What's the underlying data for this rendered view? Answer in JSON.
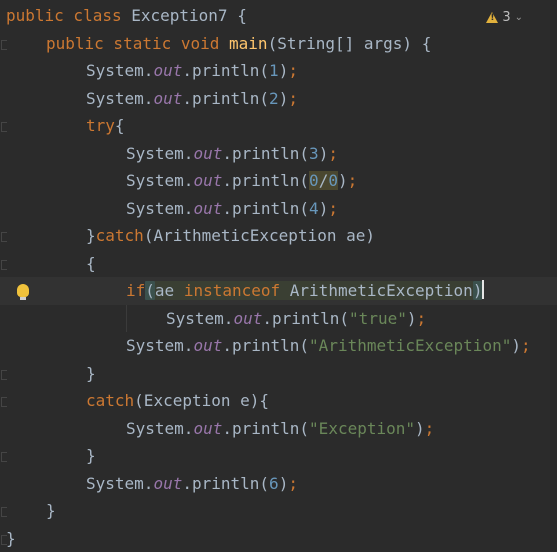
{
  "editor": {
    "inspections": {
      "warning_count": "3"
    },
    "lines": [
      {
        "segments": [
          [
            "kw",
            "public class "
          ],
          [
            "ident",
            "Exception7 {"
          ]
        ]
      },
      {
        "segments": [
          [
            "kw",
            "public static void "
          ],
          [
            "fn",
            "main"
          ],
          [
            "ident",
            "(String[] args) {"
          ]
        ]
      },
      {
        "segments": [
          [
            "ident",
            "System."
          ],
          [
            "fld",
            "out"
          ],
          [
            "ident",
            ".println("
          ],
          [
            "num",
            "1"
          ],
          [
            "ident",
            ")"
          ],
          [
            "kw",
            ";"
          ]
        ]
      },
      {
        "segments": [
          [
            "ident",
            "System."
          ],
          [
            "fld",
            "out"
          ],
          [
            "ident",
            ".println("
          ],
          [
            "num",
            "2"
          ],
          [
            "ident",
            ")"
          ],
          [
            "kw",
            ";"
          ]
        ]
      },
      {
        "segments": [
          [
            "kw",
            "try"
          ],
          [
            "ident",
            "{"
          ]
        ]
      },
      {
        "segments": [
          [
            "ident",
            "System."
          ],
          [
            "fld",
            "out"
          ],
          [
            "ident",
            ".println("
          ],
          [
            "num",
            "3"
          ],
          [
            "ident",
            ")"
          ],
          [
            "kw",
            ";"
          ]
        ]
      },
      {
        "segments": [
          [
            "ident",
            "System."
          ],
          [
            "fld",
            "out"
          ],
          [
            "ident",
            ".println("
          ],
          [
            "num zero-hl",
            "0"
          ],
          [
            "ident zero-hl",
            "/"
          ],
          [
            "num zero-hl",
            "0"
          ],
          [
            "ident",
            ")"
          ],
          [
            "kw",
            ";"
          ]
        ]
      },
      {
        "segments": [
          [
            "ident",
            "System."
          ],
          [
            "fld",
            "out"
          ],
          [
            "ident",
            ".println("
          ],
          [
            "num",
            "4"
          ],
          [
            "ident",
            ")"
          ],
          [
            "kw",
            ";"
          ]
        ]
      },
      {
        "segments": [
          [
            "ident",
            "}"
          ],
          [
            "kw",
            "catch"
          ],
          [
            "ident",
            "(ArithmeticException ae)"
          ]
        ]
      },
      {
        "segments": [
          [
            "ident",
            "{"
          ]
        ]
      },
      {
        "segments": [
          [
            "kw",
            "if"
          ],
          [
            "ident paren-hl",
            "("
          ],
          [
            "ident sel-hl",
            "ae "
          ],
          [
            "kw sel-hl",
            "instanceof "
          ],
          [
            "ident sel-hl",
            "ArithmeticException"
          ],
          [
            "ident paren-hl",
            ")"
          ]
        ]
      },
      {
        "segments": [
          [
            "ident",
            "System."
          ],
          [
            "fld",
            "out"
          ],
          [
            "ident",
            ".println("
          ],
          [
            "str",
            "\"true\""
          ],
          [
            "ident",
            ")"
          ],
          [
            "kw",
            ";"
          ]
        ]
      },
      {
        "segments": [
          [
            "ident",
            "System."
          ],
          [
            "fld",
            "out"
          ],
          [
            "ident",
            ".println("
          ],
          [
            "str",
            "\"ArithmeticException\""
          ],
          [
            "ident",
            ")"
          ],
          [
            "kw",
            ";"
          ]
        ]
      },
      {
        "segments": [
          [
            "ident",
            "}"
          ]
        ]
      },
      {
        "segments": [
          [
            "kw",
            "catch"
          ],
          [
            "ident",
            "(Exception e){"
          ]
        ]
      },
      {
        "segments": [
          [
            "ident",
            "System."
          ],
          [
            "fld",
            "out"
          ],
          [
            "ident",
            ".println("
          ],
          [
            "str",
            "\"Exception\""
          ],
          [
            "ident",
            ")"
          ],
          [
            "kw",
            ";"
          ]
        ]
      },
      {
        "segments": [
          [
            "ident",
            "}"
          ]
        ]
      },
      {
        "segments": [
          [
            "ident",
            "System."
          ],
          [
            "fld",
            "out"
          ],
          [
            "ident",
            ".println("
          ],
          [
            "num",
            "6"
          ],
          [
            "ident",
            ")"
          ],
          [
            "kw",
            ";"
          ]
        ]
      },
      {
        "segments": [
          [
            "ident",
            "}"
          ]
        ]
      },
      {
        "segments": [
          [
            "ident",
            "}"
          ]
        ]
      }
    ]
  }
}
